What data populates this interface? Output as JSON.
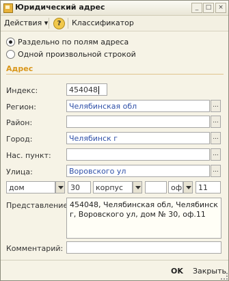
{
  "window": {
    "title": "Юридический адрес"
  },
  "titlebar_buttons": {
    "min": "_",
    "max": "□",
    "close": "×"
  },
  "toolbar": {
    "actions_label": "Действия ▾",
    "help": "?",
    "classifier_label": "Классификатор"
  },
  "mode": {
    "option_fields": "Раздельно по полям адреса",
    "option_free": "Одной произвольной строкой",
    "selected": "fields"
  },
  "group": {
    "title": "Адрес"
  },
  "fields": {
    "index": {
      "label": "Индекс:",
      "value": "454048"
    },
    "region": {
      "label": "Регион:",
      "value": "Челябинская обл"
    },
    "district": {
      "label": "Район:",
      "value": ""
    },
    "city": {
      "label": "Город:",
      "value": "Челябинск г"
    },
    "locality": {
      "label": "Нас. пункт:",
      "value": ""
    },
    "street": {
      "label": "Улица:",
      "value": "Воровского ул"
    }
  },
  "house": {
    "type1": "дом",
    "num1": "30",
    "type2": "корпус",
    "num2": "",
    "type3": "оф.",
    "num3": "11"
  },
  "presentation": {
    "label": "Представление:",
    "value": "454048, Челябинская обл, Челябинск г, Воровского ул, дом № 30, оф.11"
  },
  "comment": {
    "label": "Комментарий:",
    "value": ""
  },
  "footer": {
    "ok": "OK",
    "close": "Закрыть"
  },
  "icons": {
    "select": "...",
    "dropdown": "chevron-down-icon"
  }
}
